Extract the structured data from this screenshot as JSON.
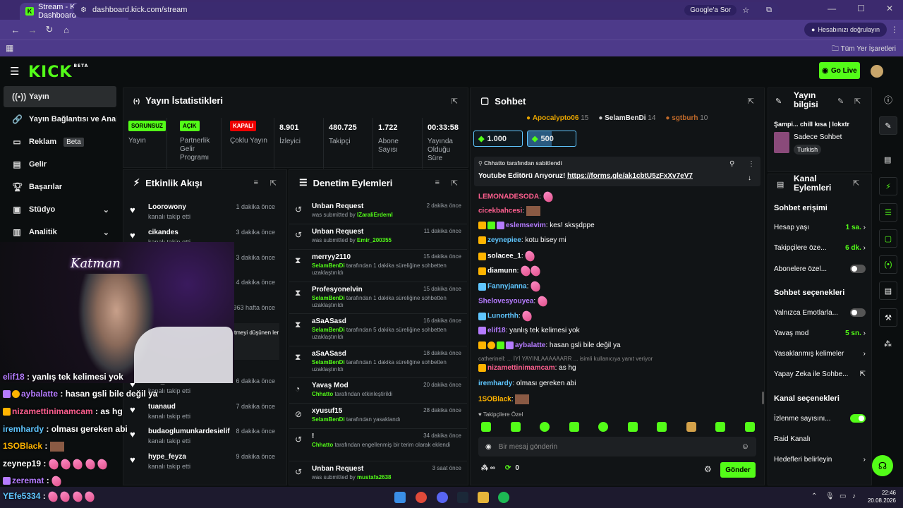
{
  "browser": {
    "tab_title": "Stream - Kick Dashboard",
    "url": "dashboard.kick.com/stream",
    "google_btn": "Google'a Sor",
    "profile_btn": "Hesabınızı doğrulayın",
    "bookmarks_all": "Tüm Yer İşaretleri"
  },
  "header": {
    "logo": "KICK",
    "logo_beta": "BETA",
    "go_live": "Go Live"
  },
  "sidebar": {
    "items": [
      {
        "label": "Yayın"
      },
      {
        "label": "Yayın Bağlantısı ve Anahtarı"
      },
      {
        "label": "Reklam",
        "badge": "Beta"
      },
      {
        "label": "Gelir"
      },
      {
        "label": "Başarılar"
      },
      {
        "label": "Stüdyo"
      },
      {
        "label": "Analitik"
      }
    ]
  },
  "stats": {
    "title": "Yayın İstatistikleri",
    "cols": [
      {
        "badge": "SORUNSUZ",
        "label": "Yayın"
      },
      {
        "badge": "AÇIK",
        "label": "Partnerlik Gelir Programı"
      },
      {
        "badge": "KAPALI",
        "label": "Çoklu Yayın"
      },
      {
        "value": "8.901",
        "label": "İzleyici"
      },
      {
        "value": "480.725",
        "label": "Takipçi"
      },
      {
        "value": "1.722",
        "label": "Abone Sayısı"
      },
      {
        "value": "00:33:58",
        "label": "Yayında Olduğu Süre"
      }
    ]
  },
  "activity": {
    "title": "Etkinlik Akışı",
    "rows": [
      {
        "name": "Loorowony",
        "sub": "kanalı takip etti",
        "time": "1 dakika önce"
      },
      {
        "name": "cikandes",
        "sub": "kanalı takip etti",
        "time": "3 dakika önce"
      },
      {
        "name": "",
        "sub": "",
        "time": "3 dakika önce"
      },
      {
        "name": "",
        "sub": "",
        "time": "4 dakika önce"
      },
      {
        "name": "",
        "sub": "",
        "time": "1.963 hafta önce"
      },
      {
        "name": "Yks_2024",
        "sub": "kanalı takip etti",
        "time": "6 dakika önce"
      },
      {
        "name": "tuanaud",
        "sub": "kanalı takip etti",
        "time": "7 dakika önce"
      },
      {
        "name": "budaoglumunkardesielif",
        "sub": "kanalı takip etti",
        "time": "8 dakika önce"
      },
      {
        "name": "hype_feyza",
        "sub": "kanalı takip etti",
        "time": "9 dakika önce"
      }
    ],
    "partial_text": "tmeyi düşünen ler"
  },
  "moderation": {
    "title": "Denetim Eylemleri",
    "rows": [
      {
        "title": "Unban Request",
        "pre": "was submitted by ",
        "user": "IZaraliErdemI",
        "post": "",
        "time": "2 dakika önce"
      },
      {
        "title": "Unban Request",
        "pre": "was submitted by ",
        "user": "Emir_200355",
        "post": "",
        "time": "11 dakika önce"
      },
      {
        "title": "merryy2110",
        "pre": "",
        "user": "SelamBenDi",
        "post": " tarafından 1 dakika süreliğine sohbetten uzaklaştırıldı",
        "time": "15 dakika önce"
      },
      {
        "title": "Profesyonelvin",
        "pre": "",
        "user": "SelamBenDi",
        "post": " tarafından 1 dakika süreliğine sohbetten uzaklaştırıldı",
        "time": "15 dakika önce"
      },
      {
        "title": "aSaASasd",
        "pre": "",
        "user": "SelamBenDi",
        "post": " tarafından 5 dakika süreliğine sohbetten uzaklaştırıldı",
        "time": "16 dakika önce"
      },
      {
        "title": "aSaASasd",
        "pre": "",
        "user": "SelamBenDi",
        "post": " tarafından 1 dakika süreliğine sohbetten uzaklaştırıldı",
        "time": "18 dakika önce"
      },
      {
        "title": "Yavaş Mod",
        "pre": "",
        "user": "Chhatto",
        "post": " tarafından etkinleştirildi",
        "time": "20 dakika önce"
      },
      {
        "title": "xyusuf15",
        "pre": "",
        "user": "SelamBenDi",
        "post": " tarafından yasaklandı",
        "time": "28 dakika önce"
      },
      {
        "title": "!",
        "pre": "",
        "user": "Chhatto",
        "post": " tarafından engellenmiş bir terim olarak eklendi",
        "time": "34 dakika önce"
      },
      {
        "title": "Unban Request",
        "pre": "was submitted by ",
        "user": "mustafa2638",
        "post": "",
        "time": "3 saat önce"
      }
    ]
  },
  "chat": {
    "title": "Sohbet",
    "top_gifters": [
      {
        "name": "Apocalypto06",
        "count": "15"
      },
      {
        "name": "SelamBenDi",
        "count": "14"
      },
      {
        "name": "sgtburh",
        "count": "10"
      }
    ],
    "goal1": "1.000",
    "goal2": "500",
    "pinned_by": "Chhatto tarafından sabitlendi",
    "pinned_text": "Youtube Editörü Arıyoruz!",
    "pinned_link": "https://forms.gle/ak1cbtU5zFxXv7eV7",
    "messages": [
      {
        "user": "LEMONADESODA",
        "color": "#ff5f8f",
        "text": ""
      },
      {
        "user": "cicekbahcesi",
        "color": "#ff5f8f",
        "text": ""
      },
      {
        "user": "eslemsevim",
        "color": "#b57bff",
        "text": "kes! sksşdppe"
      },
      {
        "user": "zeynepiee",
        "color": "#5fc6ff",
        "text": "kotu bisey mi"
      },
      {
        "user": "solacee_1",
        "color": "#fff",
        "text": ""
      },
      {
        "user": "diamunn",
        "color": "#fff",
        "text": ""
      },
      {
        "user": "Fannyjanna",
        "color": "#5fc6ff",
        "text": ""
      },
      {
        "user": "Shelovesyouyea",
        "color": "#b57bff",
        "text": ""
      },
      {
        "user": "Lunorthh",
        "color": "#5fc6ff",
        "text": ""
      },
      {
        "user": "elif18",
        "color": "#b57bff",
        "text": "yanlış tek kelimesi yok"
      },
      {
        "user": "aybalatte",
        "color": "#b57bff",
        "text": "hasan gsli bile değil ya"
      },
      {
        "user": "nizamettinimamcam",
        "color": "#ff5f8f",
        "text": "as hg"
      },
      {
        "user": "iremhardy",
        "color": "#5fc6ff",
        "text": "olması gereken abi"
      },
      {
        "user": "1SOBlack",
        "color": "#ffb400",
        "text": ""
      }
    ],
    "reply_line": "catherinell: ... İYİ YAYINLAAAAAARR ... isimli kullanıcıya yanıt veriyor",
    "followers_only": "Takipçilere Özel",
    "input_placeholder": "Bir mesaj gönderin",
    "points": "0",
    "send": "Gönder"
  },
  "stream_info": {
    "title": "Yayın bilgisi",
    "stream_title": "Şampi... chill kısa | lokxtr",
    "category": "Sadece Sohbet",
    "tag": "Turkish"
  },
  "channel_actions": {
    "title": "Kanal Eylemleri",
    "chat_access": "Sohbet erişimi",
    "account_age_label": "Hesap yaşı",
    "account_age_value": "1 sa.",
    "followers_only_label": "Takipçilere öze...",
    "followers_only_value": "6 dk.",
    "subs_only_label": "Abonelere özel...",
    "chat_options": "Sohbet seçenekleri",
    "emote_only_label": "Yalnızca Emotlarla...",
    "slow_mode_label": "Yavaş mod",
    "slow_mode_value": "5 sn.",
    "banned_words_label": "Yasaklanmış kelimeler",
    "ai_label": "Yapay Zeka ile Sohbe...",
    "channel_options": "Kanal seçenekleri",
    "viewer_count_label": "İzlenme sayısını...",
    "raid_label": "Raid Kanalı",
    "goals_label": "Hedefleri belirleyin"
  },
  "video_overlay": {
    "sign": "Katman",
    "lines": [
      {
        "user": "elif18",
        "text": "yanlış tek kelimesi yok",
        "color": "#b57bff"
      },
      {
        "user": "aybalatte",
        "text": "hasan gsli bile değil ya",
        "color": "#b57bff"
      },
      {
        "user": "nizamettinimamcam",
        "text": "as hg",
        "color": "#ff5f8f"
      },
      {
        "user": "iremhardy",
        "text": "olması gereken abi",
        "color": "#5fc6ff"
      },
      {
        "user": "1SOBlack",
        "text": "",
        "color": "#ffb400"
      },
      {
        "user": "zeynep19",
        "text": "",
        "color": "#fff"
      },
      {
        "user": "zeremat",
        "text": "",
        "color": "#b57bff"
      },
      {
        "user": "YEfe5334",
        "text": "",
        "color": "#5fc6ff"
      }
    ]
  },
  "taskbar": {
    "time": "22:46",
    "date": "20.08.2026"
  },
  "colors": {
    "accent": "#53fc18",
    "bg": "#0b0e0f",
    "panel": "#111416",
    "browser": "#4d3a8a"
  }
}
